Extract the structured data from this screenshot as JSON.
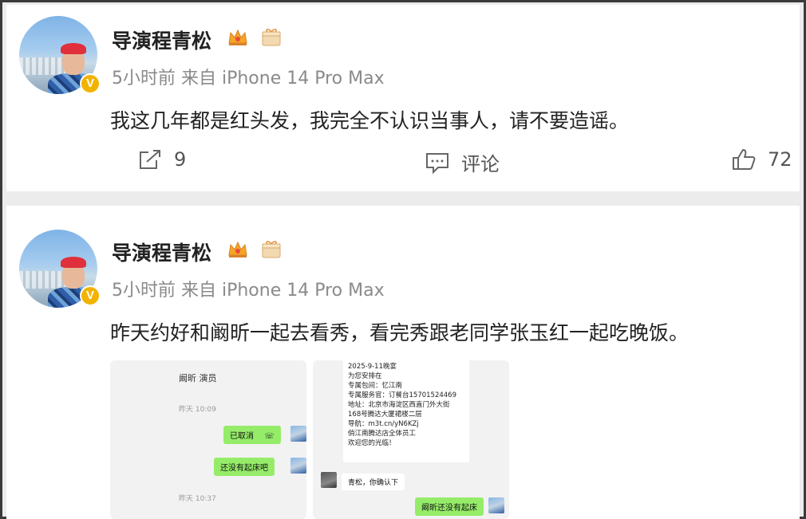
{
  "posts": [
    {
      "username": "导演程青松",
      "verified_mark": "V",
      "meta": "5小时前 来自 iPhone 14 Pro Max",
      "content": "我这几年都是红头发，我完全不认识当事人，请不要造谣。",
      "actions": {
        "repost_count": "9",
        "comment_label": "评论",
        "like_count": "72"
      }
    },
    {
      "username": "导演程青松",
      "verified_mark": "V",
      "meta": "5小时前 来自 iPhone 14 Pro Max",
      "content": "昨天约好和阚昕一起去看秀，看完秀跟老同学张玉红一起吃晚饭。",
      "images": {
        "chat1": {
          "title": "阚昕 演员",
          "time1": "昨天 10:09",
          "bubble1": "已取消",
          "bubble2": "还没有起床吧",
          "time2": "昨天 10:37"
        },
        "chat2": {
          "card_lines": [
            "2025-9-11晚宴",
            "为您安排在",
            "专属包间：忆江南",
            "专属服务官：订餐台15701524469",
            "地址：北京市海淀区西直门外大街",
            "168号腾达大厦裙楼二层",
            "导航：m3t.cn/yN6KZj",
            "",
            "俏江南腾达店全体员工",
            "欢迎您的光临！"
          ],
          "reply_left": "青松，你确认下",
          "reply_right": "阚昕还没有起床"
        }
      }
    }
  ],
  "colors": {
    "page_bg": "#ececec",
    "card_bg": "#ffffff",
    "meta_gray": "#8a8a8a",
    "verified_gold": "#f2b300",
    "wechat_green": "#95ec69"
  },
  "icons": [
    "repost-icon",
    "comment-icon",
    "like-icon",
    "crown-badge-icon",
    "gift-badge-icon"
  ]
}
